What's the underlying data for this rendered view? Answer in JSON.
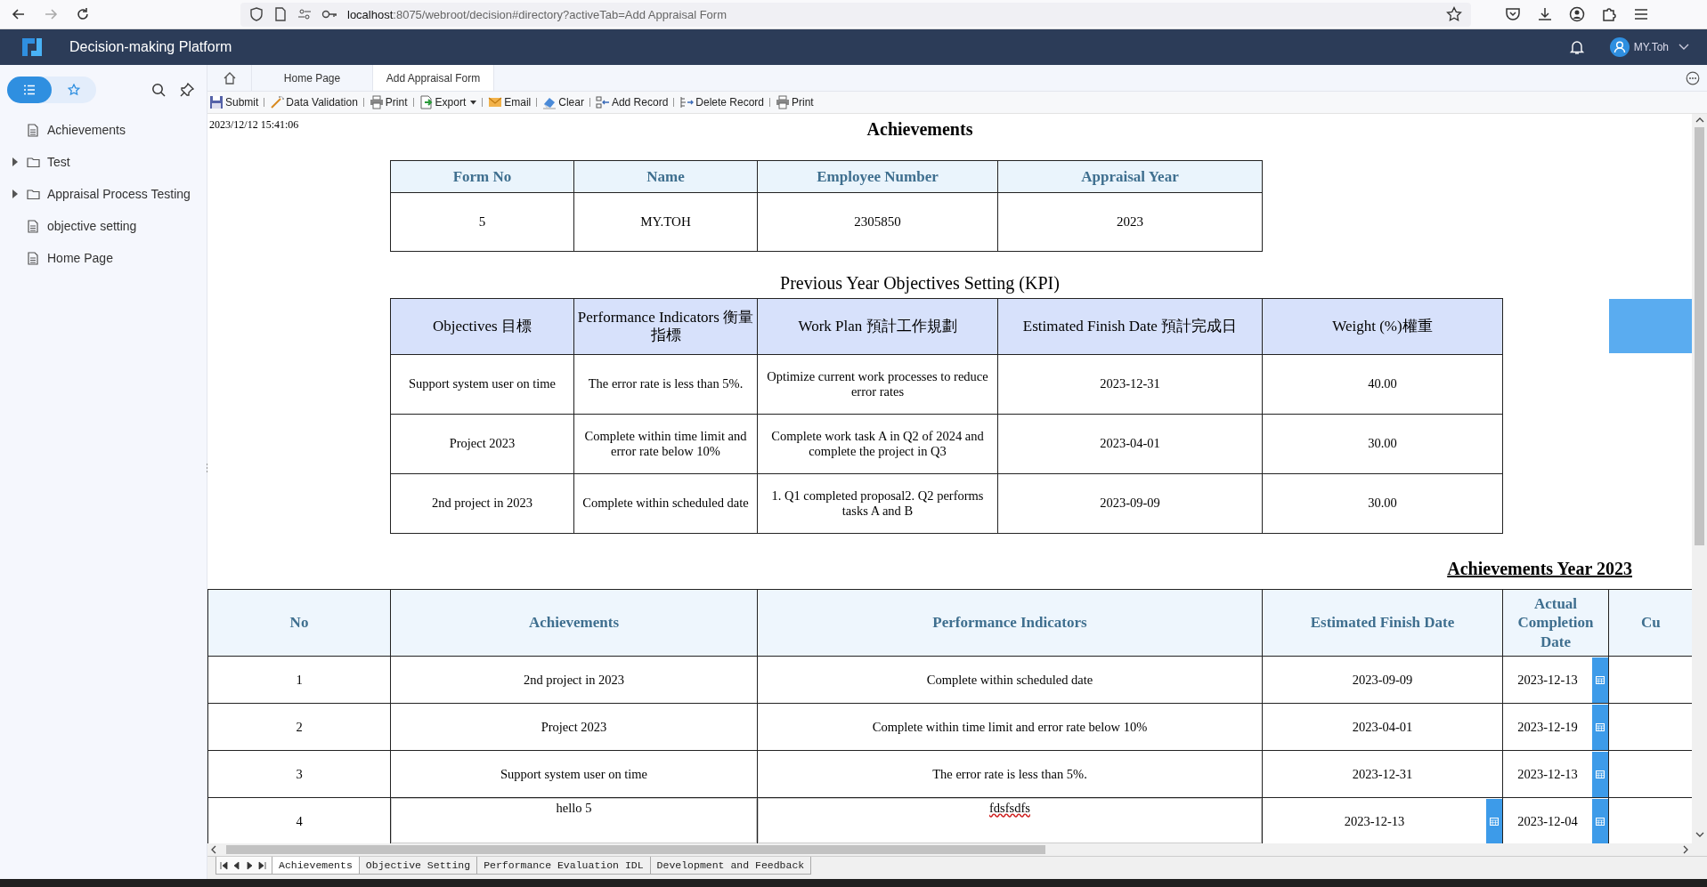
{
  "browser": {
    "url_host": "localhost",
    "url_rest": ":8075/webroot/decision#directory?activeTab=Add Appraisal Form"
  },
  "app": {
    "title": "Decision-making Platform",
    "user": "MY.Toh"
  },
  "sidebar": {
    "view_toggle": [
      {
        "selected": true
      },
      {
        "selected": false
      }
    ],
    "items": [
      {
        "label": "Achievements",
        "kind": "file",
        "expanded": false
      },
      {
        "label": "Test",
        "kind": "folder",
        "expanded": false
      },
      {
        "label": "Appraisal Process Testing",
        "kind": "folder",
        "expanded": false
      },
      {
        "label": "objective setting",
        "kind": "file",
        "expanded": false
      },
      {
        "label": "Home Page",
        "kind": "file",
        "expanded": false
      }
    ]
  },
  "tabs": [
    {
      "label": "Home Page",
      "selected": false
    },
    {
      "label": "Add Appraisal Form",
      "selected": true
    }
  ],
  "toolbar": [
    {
      "label": "Submit",
      "menu": false
    },
    {
      "label": "Data Validation",
      "menu": false
    },
    {
      "label": "Print",
      "menu": false
    },
    {
      "label": "Export",
      "menu": true
    },
    {
      "label": "Email",
      "menu": false
    },
    {
      "label": "Clear",
      "menu": false
    },
    {
      "label": "Add Record",
      "menu": false
    },
    {
      "label": "Delete Record",
      "menu": false
    },
    {
      "label": "Print",
      "menu": false
    }
  ],
  "report": {
    "timestamp": "2023/12/12 15:41:06",
    "title": "Achievements",
    "info_table": {
      "columns": [
        "Form No",
        "Name",
        "Employee Number",
        "Appraisal Year"
      ],
      "row": [
        "5",
        "MY.TOH",
        "2305850",
        "2023"
      ]
    },
    "kpi_title": "Previous Year Objectives Setting (KPI)",
    "kpi_table": {
      "columns": [
        "Objectives 目標",
        "Performance Indicators 衡量指標",
        "Work Plan 預計工作規劃",
        "Estimated Finish Date 預計完成日",
        "Weight (%)權重"
      ],
      "rows": [
        [
          "Support system user on time",
          "The error rate is less than 5%.",
          "Optimize current work processes to reduce error rates",
          "2023-12-31",
          "40.00"
        ],
        [
          "Project 2023",
          "Complete within time limit and error rate below 10%",
          "Complete work task A in Q2 of 2024 and complete the project in Q3",
          "2023-04-01",
          "30.00"
        ],
        [
          "2nd project in 2023",
          "Complete within scheduled date",
          "1. Q1 completed proposal2. Q2 performs tasks A and B",
          "2023-09-09",
          "30.00"
        ]
      ]
    },
    "achievements_title": "Achievements Year 2023",
    "achievements_table": {
      "columns": [
        "No",
        "Achievements",
        "Performance Indicators",
        "Estimated Finish Date",
        "Actual Completion Date",
        "Cu"
      ],
      "rows": [
        {
          "no": "1",
          "achievement": "2nd project in 2023",
          "indicator": "Complete within scheduled date",
          "estimated": "2023-09-09",
          "actual": "2023-12-13",
          "editable": false,
          "misspelled": false
        },
        {
          "no": "2",
          "achievement": "Project 2023",
          "indicator": "Complete within time limit and error rate below 10%",
          "estimated": "2023-04-01",
          "actual": "2023-12-19",
          "editable": false,
          "misspelled": false
        },
        {
          "no": "3",
          "achievement": "Support system user on time",
          "indicator": "The error rate is less than 5%.",
          "estimated": "2023-12-31",
          "actual": "2023-12-13",
          "editable": false,
          "misspelled": false
        },
        {
          "no": "4",
          "achievement": "hello 5",
          "indicator": "fdsfsdfs",
          "estimated": "2023-12-13",
          "actual": "2023-12-04",
          "editable": true,
          "misspelled": true
        }
      ]
    }
  },
  "sheet_tabs": [
    {
      "label": "Achievements",
      "selected": true
    },
    {
      "label": "Objective Setting",
      "selected": false
    },
    {
      "label": "Performance Evaluation IDL",
      "selected": false
    },
    {
      "label": "Development and Feedback",
      "selected": false
    }
  ]
}
